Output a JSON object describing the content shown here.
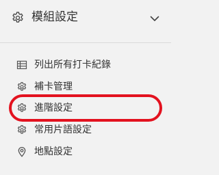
{
  "header": {
    "title": "模組設定",
    "icon": "gear-icon",
    "toggle_icon": "chevron-down-icon"
  },
  "menu": {
    "items": [
      {
        "label": "列出所有打卡紀錄",
        "icon": "table-icon"
      },
      {
        "label": "補卡管理",
        "icon": "gear-icon"
      },
      {
        "label": "進階設定",
        "icon": "gear-icon",
        "highlighted": true
      },
      {
        "label": "常用片語設定",
        "icon": "gear-icon"
      },
      {
        "label": "地點設定",
        "icon": "location-pin-icon"
      }
    ]
  },
  "colors": {
    "background": "#f2f2f2",
    "text": "#333333",
    "divider": "#d9d9d9",
    "highlight": "#e3121f"
  }
}
